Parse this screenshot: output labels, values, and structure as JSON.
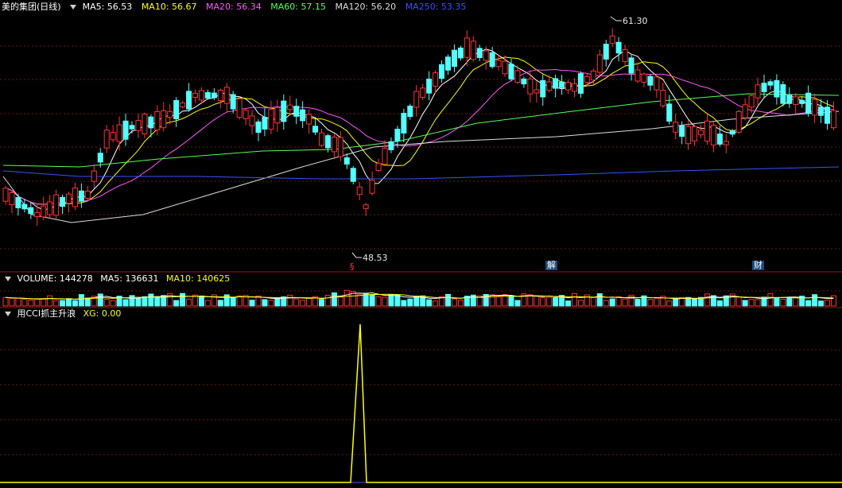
{
  "main": {
    "title": "美的集团(日线)",
    "indicators": [
      {
        "label": "MA5: 56.53",
        "color": "#ffffff"
      },
      {
        "label": "MA10: 56.67",
        "color": "#ffff00"
      },
      {
        "label": "MA20: 56.34",
        "color": "#ff55ff"
      },
      {
        "label": "MA60: 57.15",
        "color": "#55ff55"
      },
      {
        "label": "MA120: 56.20",
        "color": "#dddddd"
      },
      {
        "label": "MA250: 53.35",
        "color": "#3355ff"
      }
    ],
    "high_label": "61.30",
    "low_label": "48.53",
    "markers": [
      {
        "text": "§",
        "color": "#ff3333"
      },
      {
        "text": "解",
        "color": "#ffffff"
      },
      {
        "text": "财",
        "color": "#ffffff"
      }
    ]
  },
  "volume": {
    "title": "VOLUME: 144278",
    "ma5": "MA5: 136631",
    "ma10": "MA10: 140625"
  },
  "indicator": {
    "title": "用CCI抓主升浪",
    "xg": "XG: 0.00"
  },
  "colors": {
    "up": "#ff3232",
    "down": "#54ffff",
    "grid": "#6e1414",
    "separator": "#a01010"
  }
}
